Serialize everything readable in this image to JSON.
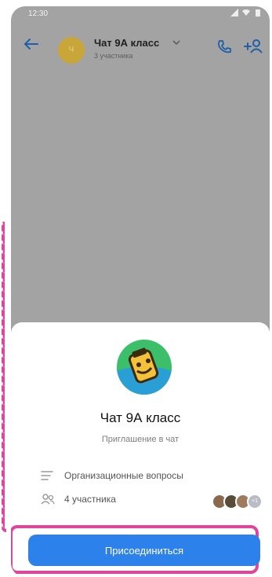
{
  "status_bar": {
    "time": "12:30"
  },
  "chat_header": {
    "title": "Чат 9А класс",
    "subtitle": "3 участника",
    "avatar_letter": "Ч"
  },
  "join_sheet": {
    "group_name": "Чат 9А класс",
    "invite_text": "Приглашение в чат",
    "description": "Организационные вопросы",
    "members_label": "4 участника",
    "extra_members_badge": "+1",
    "join_button_label": "Присоединиться"
  },
  "colors": {
    "accent": "#2d81ea",
    "highlight": "#e0459b",
    "overlay": "#a3a3a3",
    "avatar_bg": "#3cbf6a"
  },
  "icons": [
    "back-arrow-icon",
    "call-icon",
    "add-user-icon",
    "description-icon",
    "members-icon",
    "chevron-down-icon"
  ]
}
